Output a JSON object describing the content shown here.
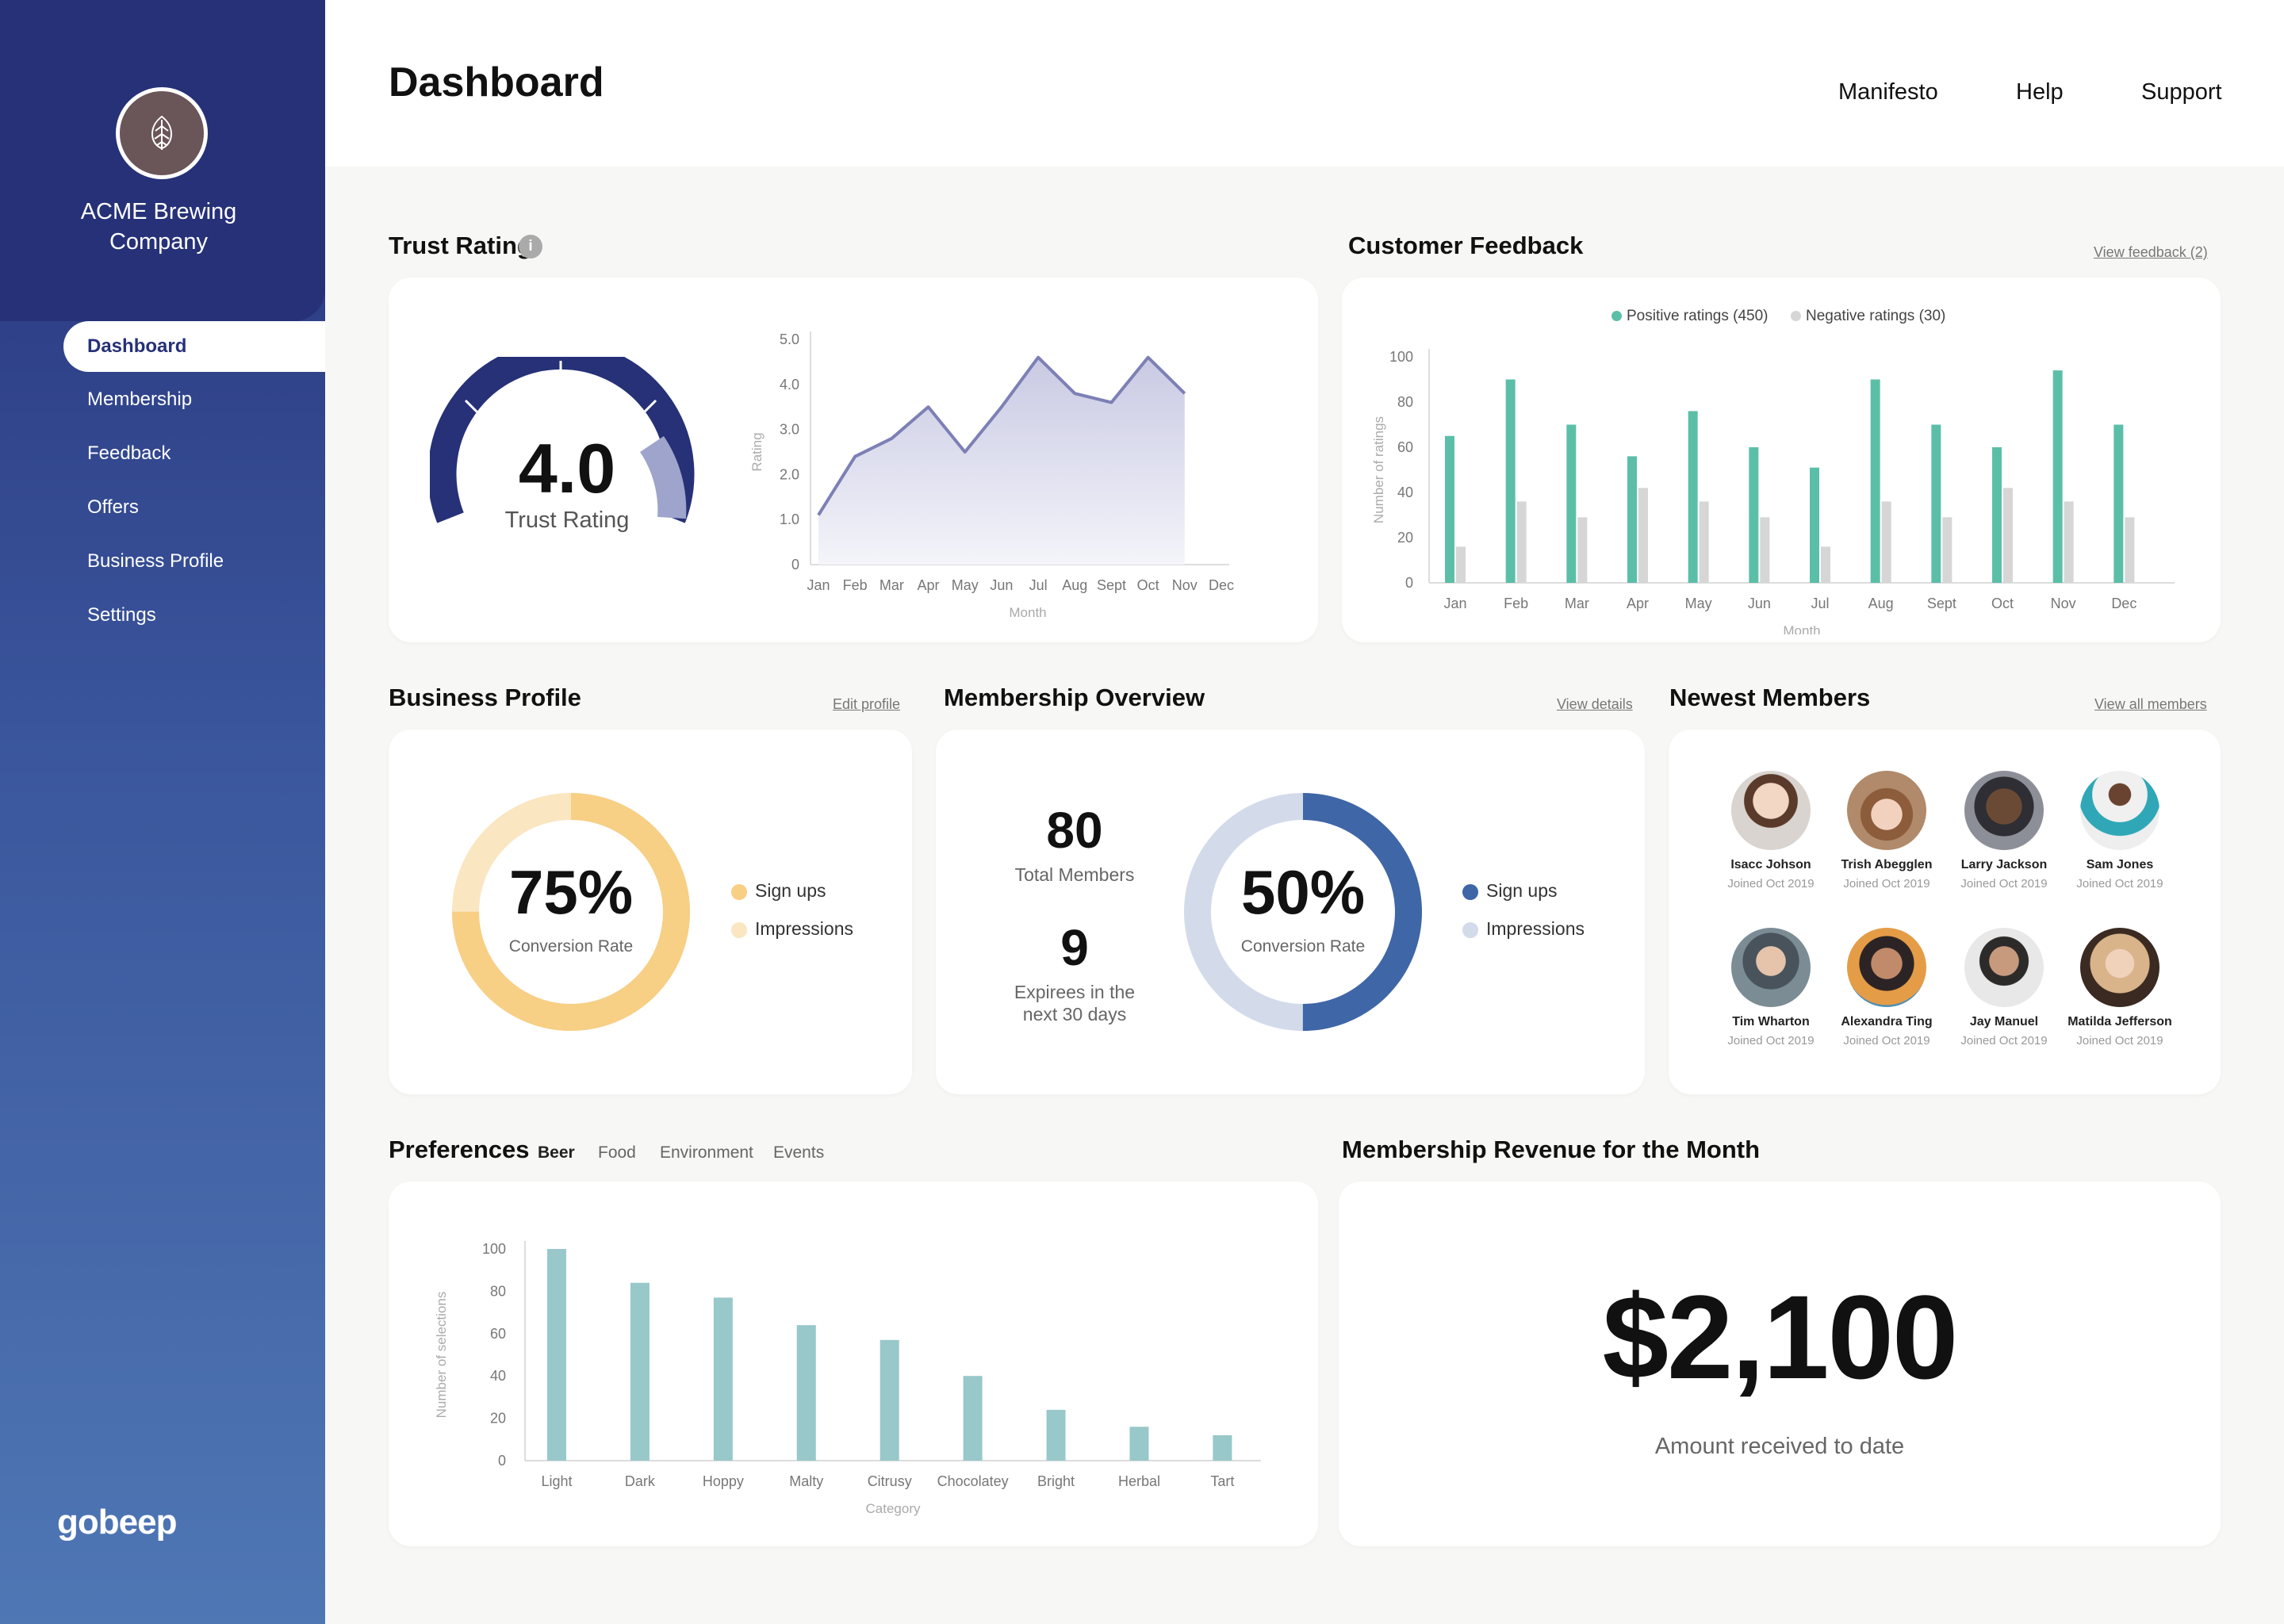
{
  "sidebar": {
    "company": "ACME Brewing Company",
    "brand": "gobeep",
    "items": [
      {
        "label": "Dashboard",
        "active": true
      },
      {
        "label": "Membership"
      },
      {
        "label": "Feedback"
      },
      {
        "label": "Offers"
      },
      {
        "label": "Business Profile"
      },
      {
        "label": "Settings"
      }
    ]
  },
  "header": {
    "title": "Dashboard",
    "links": [
      "Manifesto",
      "Help",
      "Support"
    ]
  },
  "trust": {
    "title": "Trust Rating",
    "value": "4.0",
    "label": "Trust Rating",
    "ylabel": "Rating",
    "xlabel": "Month",
    "y_ticks": [
      "5.0",
      "4.0",
      "3.0",
      "2.0",
      "1.0",
      "0"
    ]
  },
  "feedback": {
    "title": "Customer Feedback",
    "link": "View feedback (2)",
    "legend_pos": "Positive ratings (450)",
    "legend_neg": "Negative ratings (30)",
    "ylabel": "Number of ratings",
    "xlabel": "Month"
  },
  "profile": {
    "title": "Business Profile",
    "link": "Edit profile",
    "percent": "75%",
    "caption": "Conversion Rate",
    "legend1": "Sign ups",
    "legend2": "Impressions"
  },
  "membership": {
    "title": "Membership Overview",
    "link": "View details",
    "total": "80",
    "total_label": "Total Members",
    "expiring": "9",
    "expiring_label_1": "Expirees in the",
    "expiring_label_2": "next 30 days",
    "percent": "50%",
    "caption": "Conversion Rate",
    "legend1": "Sign ups",
    "legend2": "Impressions"
  },
  "members": {
    "title": "Newest Members",
    "link": "View all members",
    "list": [
      {
        "name": "Isacc Johson",
        "joined": "Joined Oct 2019"
      },
      {
        "name": "Trish Abegglen",
        "joined": "Joined Oct 2019"
      },
      {
        "name": "Larry Jackson",
        "joined": "Joined Oct 2019"
      },
      {
        "name": "Sam Jones",
        "joined": "Joined Oct 2019"
      },
      {
        "name": "Tim Wharton",
        "joined": "Joined Oct 2019"
      },
      {
        "name": "Alexandra Ting",
        "joined": "Joined Oct 2019"
      },
      {
        "name": "Jay Manuel",
        "joined": "Joined Oct 2019"
      },
      {
        "name": "Matilda Jefferson",
        "joined": "Joined Oct 2019"
      }
    ]
  },
  "preferences": {
    "title": "Preferences",
    "tabs": [
      "Beer",
      "Food",
      "Environment",
      "Events"
    ],
    "ylabel": "Number of selections",
    "xlabel": "Category"
  },
  "revenue": {
    "title": "Membership Revenue for the Month",
    "amount": "$2,100",
    "caption": "Amount received to date"
  },
  "colors": {
    "navy": "#263178",
    "teal": "#5bbfa8",
    "gray": "#d6d6d6",
    "yellow": "#f7cf85",
    "blue": "#3f66a6",
    "pref": "#98c8c9"
  },
  "chart_data": [
    {
      "type": "area",
      "categories": [
        "Jan",
        "Feb",
        "Mar",
        "Apr",
        "May",
        "Jun",
        "Jul",
        "Aug",
        "Sept",
        "Oct",
        "Nov",
        "Dec"
      ],
      "values": [
        1.1,
        2.4,
        2.8,
        3.5,
        2.5,
        3.5,
        4.6,
        3.8,
        3.6,
        4.6,
        3.8
      ],
      "x_points": [
        0,
        1,
        2,
        3,
        4,
        5,
        6,
        7,
        8,
        9,
        10
      ],
      "ylabel": "Rating",
      "xlabel": "Month",
      "ylim": [
        0,
        5
      ]
    },
    {
      "type": "bar",
      "categories": [
        "Jan",
        "Feb",
        "Mar",
        "Apr",
        "May",
        "Jun",
        "Jul",
        "Aug",
        "Sept",
        "Oct",
        "Nov",
        "Dec"
      ],
      "series": [
        {
          "name": "Positive ratings (450)",
          "values": [
            65,
            90,
            70,
            56,
            76,
            60,
            51,
            90,
            70,
            60,
            94,
            70
          ]
        },
        {
          "name": "Negative ratings (30)",
          "values": [
            16,
            36,
            29,
            42,
            36,
            29,
            16,
            36,
            29,
            42,
            36,
            29
          ]
        }
      ],
      "ylabel": "Number of ratings",
      "xlabel": "Month",
      "ylim": [
        0,
        100
      ]
    },
    {
      "type": "pie",
      "categories": [
        "Sign ups",
        "Impressions"
      ],
      "values": [
        75,
        25
      ]
    },
    {
      "type": "pie",
      "categories": [
        "Sign ups",
        "Impressions"
      ],
      "values": [
        50,
        50
      ]
    },
    {
      "type": "bar",
      "categories": [
        "Light",
        "Dark",
        "Hoppy",
        "Malty",
        "Citrusy",
        "Chocolatey",
        "Bright",
        "Herbal",
        "Tart"
      ],
      "values": [
        100,
        84,
        77,
        64,
        57,
        40,
        24,
        16,
        12
      ],
      "ylabel": "Number of selections",
      "xlabel": "Category",
      "ylim": [
        0,
        100
      ]
    }
  ]
}
